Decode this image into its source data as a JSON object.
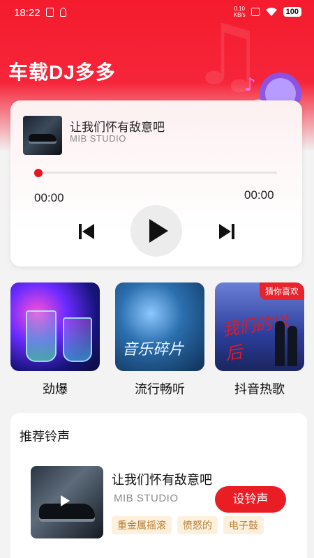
{
  "status_bar": {
    "time": "18:22",
    "net_speed_value": "0.10",
    "net_speed_unit": "KB/s",
    "battery": "100"
  },
  "app": {
    "title": "车载DJ多多"
  },
  "player": {
    "song_title": "让我们怀有敌意吧",
    "artist": "MIB STUDIO",
    "current_time": "00:00",
    "total_time": "00:00",
    "progress": 0
  },
  "categories": [
    {
      "label": "劲爆"
    },
    {
      "label": "流行畅听",
      "art_text": "音乐碎片"
    },
    {
      "label": "抖音热歌",
      "art_text": "我们的以后",
      "badge": "猜你喜欢"
    }
  ],
  "recommend": {
    "section_title": "推荐铃声",
    "item": {
      "title": "让我们怀有敌意吧",
      "artist": "MIB STUDIO",
      "button_label": "设铃声",
      "tags": [
        "重金属摇滚",
        "愤怒的",
        "电子鼓"
      ]
    }
  },
  "colors": {
    "accent": "#ea1c24",
    "tag_bg": "#fdf1dd",
    "tag_text": "#b67c33"
  },
  "icons": [
    "skip-previous-icon",
    "play-icon",
    "skip-next-icon",
    "music-note-icon",
    "microphone-icon"
  ]
}
